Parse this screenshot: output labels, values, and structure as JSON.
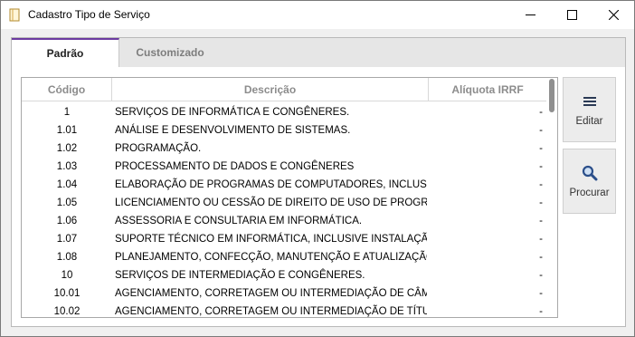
{
  "window": {
    "title": "Cadastro Tipo de Serviço",
    "icons": {
      "app": "document-icon",
      "minimize": "minimize-icon",
      "maximize": "maximize-icon",
      "close": "close-icon"
    }
  },
  "tabs": [
    {
      "label": "Padrão",
      "active": true
    },
    {
      "label": "Customizado",
      "active": false
    }
  ],
  "grid": {
    "columns": [
      "Código",
      "Descrição",
      "Alíquota IRRF"
    ],
    "rows": [
      {
        "code": "1",
        "description": "SERVIÇOS DE INFORMÁTICA E CONGÊNERES.",
        "aliquota": "-"
      },
      {
        "code": "1.01",
        "description": "ANÁLISE E DESENVOLVIMENTO DE SISTEMAS.",
        "aliquota": "-"
      },
      {
        "code": "1.02",
        "description": "PROGRAMAÇÃO.",
        "aliquota": "-"
      },
      {
        "code": "1.03",
        "description": "PROCESSAMENTO DE DADOS E CONGÊNERES",
        "aliquota": "-"
      },
      {
        "code": "1.04",
        "description": "ELABORAÇÃO DE PROGRAMAS DE COMPUTADORES, INCLUSIVE D",
        "aliquota": "-"
      },
      {
        "code": "1.05",
        "description": "LICENCIAMENTO OU CESSÃO DE DIREITO DE USO DE PROGRAMA",
        "aliquota": "-"
      },
      {
        "code": "1.06",
        "description": "ASSESSORIA E CONSULTARIA EM INFORMÁTICA.",
        "aliquota": "-"
      },
      {
        "code": "1.07",
        "description": "SUPORTE TÉCNICO EM INFORMÁTICA, INCLUSIVE INSTALAÇÃO, C",
        "aliquota": "-"
      },
      {
        "code": "1.08",
        "description": "PLANEJAMENTO, CONFECÇÃO, MANUTENÇÃO E ATUALIZAÇÃO D",
        "aliquota": "-"
      },
      {
        "code": "10",
        "description": "SERVIÇOS DE INTERMEDIAÇÃO E CONGÊNERES.",
        "aliquota": "-"
      },
      {
        "code": "10.01",
        "description": "AGENCIAMENTO, CORRETAGEM OU INTERMEDIAÇÃO DE CÂMBIC",
        "aliquota": "-"
      },
      {
        "code": "10.02",
        "description": "AGENCIAMENTO, CORRETAGEM OU INTERMEDIAÇÃO DE TÍTULOS",
        "aliquota": "-"
      }
    ]
  },
  "actions": {
    "edit": {
      "label": "Editar",
      "icon": "menu-lines-icon"
    },
    "search": {
      "label": "Procurar",
      "icon": "magnifier-icon"
    }
  },
  "colors": {
    "tab_accent": "#6b3aa0",
    "icon_blue": "#2b4f8a"
  }
}
